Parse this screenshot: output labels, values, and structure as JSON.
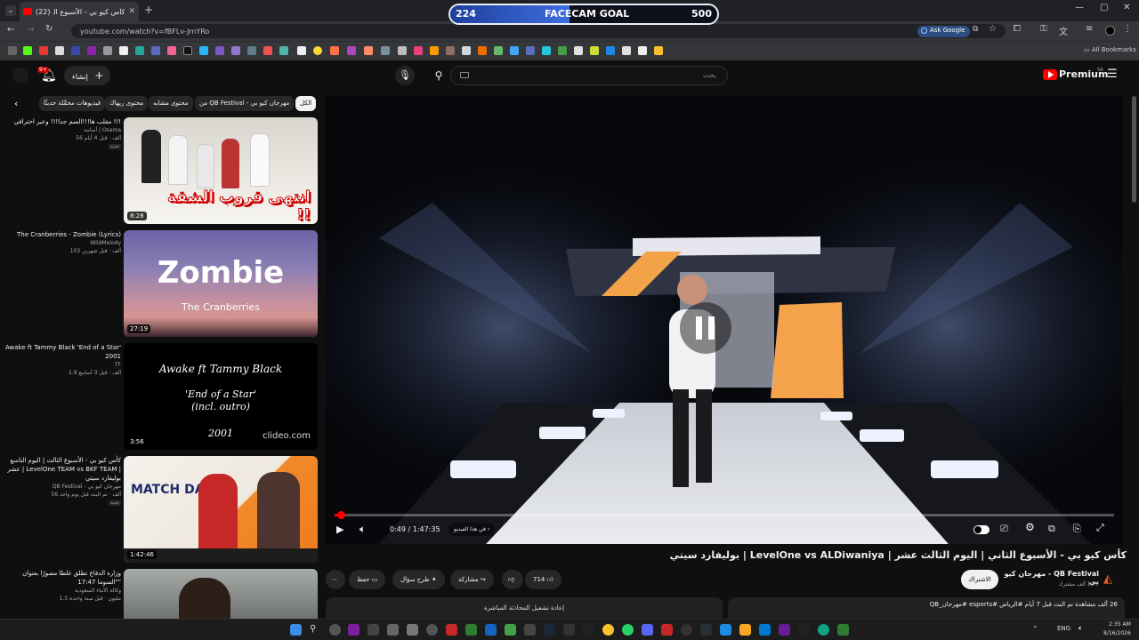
{
  "browser": {
    "tab_title": "كأس كيو بي - الأسبوع الثا...",
    "tab_count_badge": "(22)",
    "url": "youtube.com/watch?v=fBFLv-JmYRo",
    "ask_google": "Ask Google",
    "all_bookmarks": "All Bookmarks"
  },
  "overlay": {
    "goal_label": "FACECAM GOAL",
    "goal_current": "224",
    "goal_target": "500",
    "goal_progress": 0.448
  },
  "youtube": {
    "create_label": "إنشاء",
    "notif_badge": "9+",
    "search_placeholder": "بحث",
    "premium_label": "Premium",
    "premium_region": "SA"
  },
  "chips": [
    "الكل",
    "من QB Festival - مهرجان كيو بي",
    "محتوى مشابه",
    "محتوى ريهاك",
    "فيديوهات محمَّلة حديثًا"
  ],
  "recommendations": [
    {
      "title": "مقلب ها!!!السم جدا!!! وعبر احترافي !!!",
      "channel": "أسامة | Osama",
      "stats": "56 ألف  ·  قبل 4 أيام",
      "badge": "جديد",
      "duration": "8:28",
      "thumb_text": "انتهى قروب الشقة !!"
    },
    {
      "title": "The Cranberries - Zombie (Lyrics)",
      "channel": "WildMelody",
      "stats": "103 ألف  ·  قبل شهرين",
      "duration": "27:19",
      "thumb_title": "Zombie",
      "thumb_sub": "The Cranberries"
    },
    {
      "title": "Awake ft Tammy Black 'End of a Star' 2001",
      "channel": "TF",
      "stats": "1.9 ألف  ·  قبل 3 أسابيع",
      "duration": "3:56",
      "thumb_lines": [
        "Awake ft Tammy Black",
        "'End of a Star'",
        "(incl. outro)",
        "2001"
      ],
      "thumb_brand": "clideo.com"
    },
    {
      "title": "كأس كيو بي - الأسبوع الثالث | اليوم التاسع عشر | LevelOne TEAM vs BKF TEAM | بوليفارد سيتي",
      "channel": "QB Festival - مهرجان كيو بي",
      "stats": "56 ألف  ·  تم البث قبل يوم واحد",
      "badge": "جديد",
      "duration": "1:42:46",
      "thumb_text": "MATCH DAY"
    },
    {
      "title": "وزارة الدفاع تطلق غلطا مصورًا بعنوان \"السوما 17:47\"",
      "channel": "وكالة الأنباء السعودية",
      "stats": "1.5 مليون  ·  قبل سنة واحدة"
    }
  ],
  "player": {
    "time_current": "0:49",
    "time_total": "1:47:35",
    "chapter": "في هذا الفيديو",
    "progress": 0.008
  },
  "video": {
    "title": "كأس كيو بي - الأسبوع الثاني | اليوم الثالث عشر | LevelOne vs ALDiwaniya | بوليفارد سيتي",
    "channel": "QB Festival - مهرجان كيو بي",
    "subscribers": "14.7 ألف مشترك",
    "subscribe_label": "الاشتراك",
    "likes": "714",
    "share_label": "مشاركة",
    "ask_label": "طرح سؤال",
    "save_label": "حفظ",
    "views_line": "26 ألف مشاهدة  تم البث قبل 7 أيام  #الرياض #esports #مهرجان_QB",
    "live_chat_replay": "إعادة تشغيل المحادثة المباشرة"
  },
  "taskbar": {
    "time": "2:35 AM",
    "date": "8/16/2026",
    "lang": "ENG"
  }
}
